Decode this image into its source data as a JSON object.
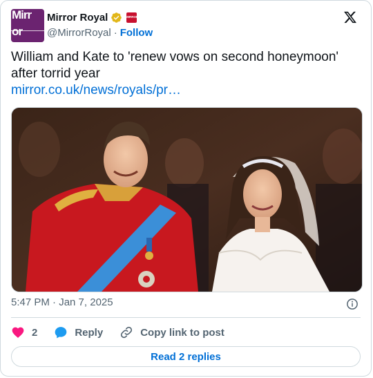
{
  "account": {
    "avatar_text_line1": "Mirr",
    "avatar_text_line2": "or",
    "name": "Mirror Royal",
    "handle": "@MirrorRoyal",
    "separator": "·",
    "follow_label": "Follow",
    "affiliate_badge_text": "MIRROR"
  },
  "tweet": {
    "text": "William and Kate to 'renew vows on second honeymoon' after torrid year",
    "link": "mirror.co.uk/news/royals/pr…",
    "timestamp": "5:47 PM · Jan 7, 2025"
  },
  "actions": {
    "like_count": "2",
    "reply_label": "Reply",
    "copy_label": "Copy link to post"
  },
  "footer": {
    "read_replies_label": "Read 2 replies"
  },
  "colors": {
    "brand_purple": "#6b2370",
    "link_blue": "#006fd6",
    "heart_pink": "#f91880",
    "reply_blue": "#1d9bf0",
    "verified_gold": "#e2b719"
  }
}
